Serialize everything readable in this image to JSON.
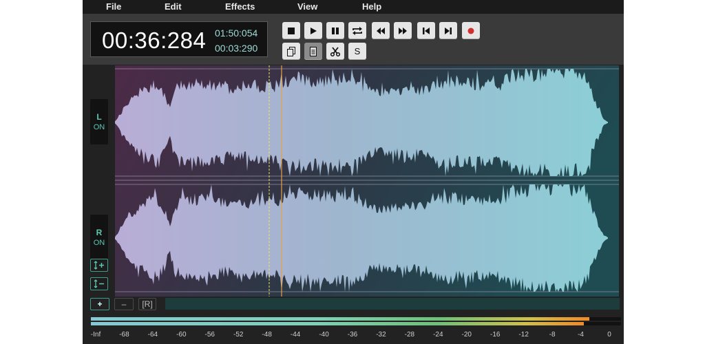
{
  "menu": [
    "File",
    "Edit",
    "Effects",
    "View",
    "Help"
  ],
  "time": {
    "main": "00:36:284",
    "total": "01:50:054",
    "selection": "00:03:290"
  },
  "toolbar": {
    "row1": [
      {
        "name": "stop-button",
        "icon": "stop-icon"
      },
      {
        "name": "play-button",
        "icon": "play-icon"
      },
      {
        "name": "pause-button",
        "icon": "pause-icon"
      },
      {
        "name": "loop-button",
        "icon": "loop-icon"
      },
      {
        "name": "rewind-button",
        "icon": "rewind-icon"
      },
      {
        "name": "fast-forward-button",
        "icon": "fast-forward-icon"
      },
      {
        "name": "skip-start-button",
        "icon": "skip-start-icon"
      },
      {
        "name": "skip-end-button",
        "icon": "skip-end-icon"
      },
      {
        "name": "record-button",
        "icon": "record-icon"
      }
    ],
    "row2": [
      {
        "name": "copy-button",
        "icon": "copy-icon"
      },
      {
        "name": "paste-button",
        "icon": "paste-icon"
      },
      {
        "name": "cut-button",
        "icon": "scissors-icon"
      },
      {
        "name": "silence-button",
        "icon": "s-icon",
        "label": "S"
      }
    ]
  },
  "channels": [
    {
      "letter": "L",
      "state": "ON"
    },
    {
      "letter": "R",
      "state": "ON"
    }
  ],
  "scroll_controls": {
    "zoom_in": "+",
    "zoom_out": "–",
    "reset": "[R]"
  },
  "meter": {
    "ticks": [
      "-Inf",
      "-68",
      "-64",
      "-60",
      "-56",
      "-52",
      "-48",
      "-44",
      "-40",
      "-36",
      "-32",
      "-28",
      "-24",
      "-20",
      "-16",
      "-12",
      "-8",
      "-4",
      "0"
    ],
    "level_left": 0.94,
    "level_right": 0.93
  },
  "colors": {
    "accent": "#5ec8b4",
    "playhead": "#e8a040",
    "selection_marker": "#f0e060",
    "record": "#d23030"
  }
}
